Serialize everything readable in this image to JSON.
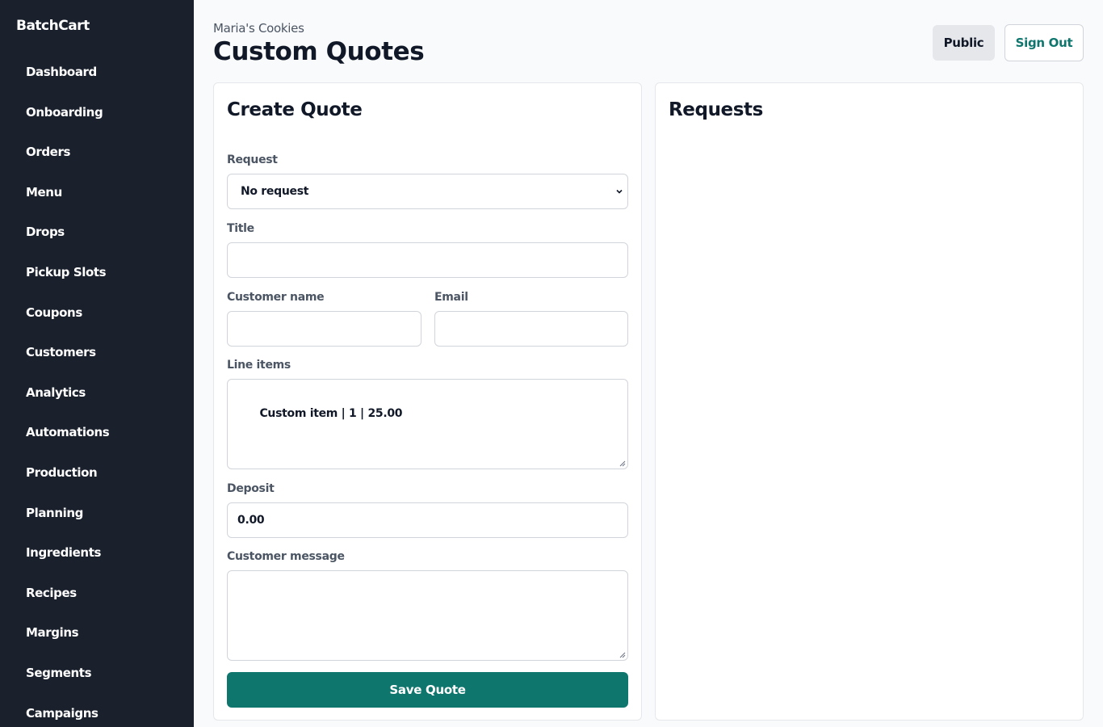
{
  "sidebar": {
    "brand": "BatchCart",
    "items": [
      {
        "label": "Dashboard"
      },
      {
        "label": "Onboarding"
      },
      {
        "label": "Orders"
      },
      {
        "label": "Menu"
      },
      {
        "label": "Drops"
      },
      {
        "label": "Pickup Slots"
      },
      {
        "label": "Coupons"
      },
      {
        "label": "Customers"
      },
      {
        "label": "Analytics"
      },
      {
        "label": "Automations"
      },
      {
        "label": "Production"
      },
      {
        "label": "Planning"
      },
      {
        "label": "Ingredients"
      },
      {
        "label": "Recipes"
      },
      {
        "label": "Margins"
      },
      {
        "label": "Segments"
      },
      {
        "label": "Campaigns"
      }
    ]
  },
  "header": {
    "shop_name": "Maria's Cookies",
    "title": "Custom Quotes",
    "public_label": "Public",
    "signout_label": "Sign Out"
  },
  "create_quote": {
    "title": "Create Quote",
    "request_label": "Request",
    "request_selected": "No request",
    "title_label": "Title",
    "title_value": "",
    "customer_name_label": "Customer name",
    "customer_name_value": "",
    "email_label": "Email",
    "email_value": "",
    "line_items_label": "Line items",
    "line_items_value": "Custom item | 1 | 25.00",
    "deposit_label": "Deposit",
    "deposit_value": "0.00",
    "customer_message_label": "Customer message",
    "customer_message_value": "",
    "save_label": "Save Quote"
  },
  "requests": {
    "title": "Requests"
  },
  "colors": {
    "sidebar_bg": "#1a202c",
    "accent": "#0f766e",
    "page_bg": "#f9fafb",
    "border": "#d1d5db"
  }
}
